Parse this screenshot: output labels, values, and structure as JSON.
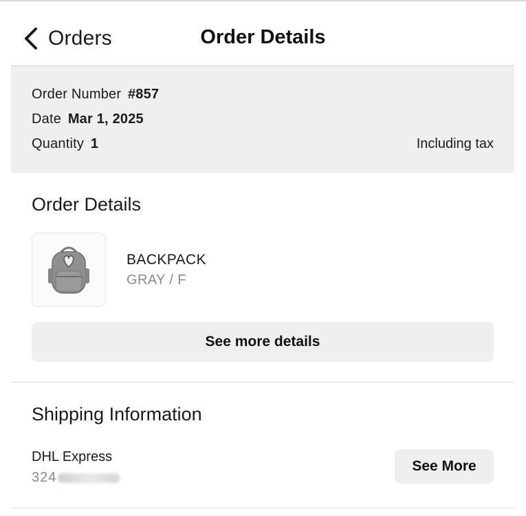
{
  "nav": {
    "back_label": "Orders",
    "title": "Order Details"
  },
  "summary": {
    "order_number_label": "Order Number",
    "order_number_value": "#857",
    "date_label": "Date",
    "date_value": "Mar 1, 2025",
    "quantity_label": "Quantity",
    "quantity_value": "1",
    "tax_note": "Including tax"
  },
  "order_details": {
    "section_title": "Order Details",
    "product": {
      "name": "BACKPACK",
      "variant": "GRAY / F",
      "image_icon": "backpack-icon"
    },
    "see_more_details_label": "See more details"
  },
  "shipping": {
    "section_title": "Shipping Information",
    "carrier": "DHL Express",
    "tracking_number": "324",
    "see_more_label": "See More"
  }
}
